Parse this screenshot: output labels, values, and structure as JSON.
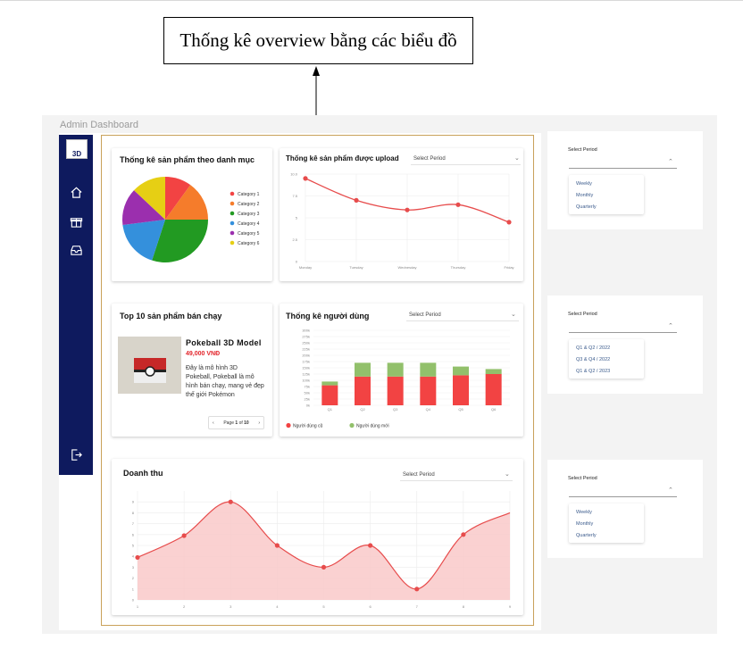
{
  "callout": {
    "label": "Thống kê overview bằng các biểu đồ"
  },
  "app": {
    "title": "Admin Dashboard",
    "logo_text": "3D"
  },
  "sidebar": {
    "items": [
      {
        "icon": "home-icon"
      },
      {
        "icon": "gift-icon"
      },
      {
        "icon": "inbox-icon"
      },
      {
        "icon": "logout-icon"
      }
    ]
  },
  "category_card": {
    "title": "Thống kê sản phẩm theo danh mục"
  },
  "upload_card": {
    "title": "Thống kê sản phẩm được upload",
    "select": "Select Period"
  },
  "top_card": {
    "title": "Top 10 sản phẩm bán chạy",
    "product": {
      "name": "Pokeball 3D Model",
      "price": "49,000 VNĐ",
      "description": "Đây là mô hình 3D Pokeball, Pokeball là mô hình bán chạy, mang vẻ đẹp thế giới Pokémon"
    },
    "pager": {
      "prev": "‹",
      "page_prefix": "Page",
      "page": "1",
      "of": "of",
      "total": "10",
      "next": "›"
    }
  },
  "users_card": {
    "title": "Thống kê người dùng",
    "select": "Select Period"
  },
  "revenue_card": {
    "title": "Doanh thu",
    "select": "Select Period"
  },
  "panels": [
    {
      "label": "Select Period",
      "options": [
        "Weekly",
        "Monthly",
        "Quarterly"
      ]
    },
    {
      "label": "Select Period",
      "options": [
        "Q1 & Q2 / 2022",
        "Q3 & Q4 / 2022",
        "Q1 & Q2 / 2023"
      ]
    },
    {
      "label": "Select Period",
      "options": [
        "Weekly",
        "Monthly",
        "Quarterly"
      ]
    }
  ],
  "colors": {
    "sidebar": "#0e1a5e",
    "red": "#f24343",
    "green": "#92c06b",
    "accent_line": "#e74c4c"
  },
  "chart_data": [
    {
      "type": "pie",
      "categories": [
        "Category 1",
        "Category 2",
        "Category 3",
        "Category 4",
        "Category 5",
        "Category 6"
      ],
      "values": [
        10,
        15,
        30,
        18,
        14,
        13
      ],
      "colors": [
        "#f24343",
        "#f57c2b",
        "#229a22",
        "#3490dc",
        "#9b2fae",
        "#e6cf14"
      ],
      "legend": "right"
    },
    {
      "type": "line",
      "x": [
        "Monday",
        "Tuesday",
        "Wednesday",
        "Thursday",
        "Friday"
      ],
      "values": [
        9.5,
        7.0,
        5.9,
        6.5,
        4.5
      ],
      "yticks": [
        "10.0",
        "7.5",
        "5",
        "2.5",
        "0"
      ],
      "ylim": [
        0,
        10
      ],
      "grid": true
    },
    {
      "type": "bar",
      "stacked": true,
      "categories": [
        "Q1",
        "Q2",
        "Q3",
        "Q4",
        "Q5",
        "Q6"
      ],
      "yticks": [
        "300k",
        "275k",
        "250k",
        "225k",
        "200k",
        "175k",
        "150k",
        "125k",
        "100k",
        "75k",
        "50k",
        "25k",
        "0k"
      ],
      "ylim": [
        0,
        300
      ],
      "series": [
        {
          "name": "Người dùng cũ",
          "values": [
            80,
            115,
            115,
            115,
            120,
            125
          ]
        },
        {
          "name": "Người dùng mới",
          "values": [
            15,
            55,
            55,
            55,
            35,
            20
          ]
        }
      ],
      "legend": "bottom"
    },
    {
      "type": "area",
      "x": [
        "1",
        "2",
        "3",
        "4",
        "5",
        "6",
        "7",
        "8",
        "9"
      ],
      "values": [
        3.9,
        5.9,
        9.0,
        5.0,
        3.0,
        5.0,
        1.0,
        6.0,
        8.0
      ],
      "yticks": [
        "0",
        "1",
        "2",
        "3",
        "4",
        "5",
        "6",
        "7",
        "8",
        "9"
      ],
      "ylim": [
        0,
        10
      ],
      "grid": true
    }
  ]
}
